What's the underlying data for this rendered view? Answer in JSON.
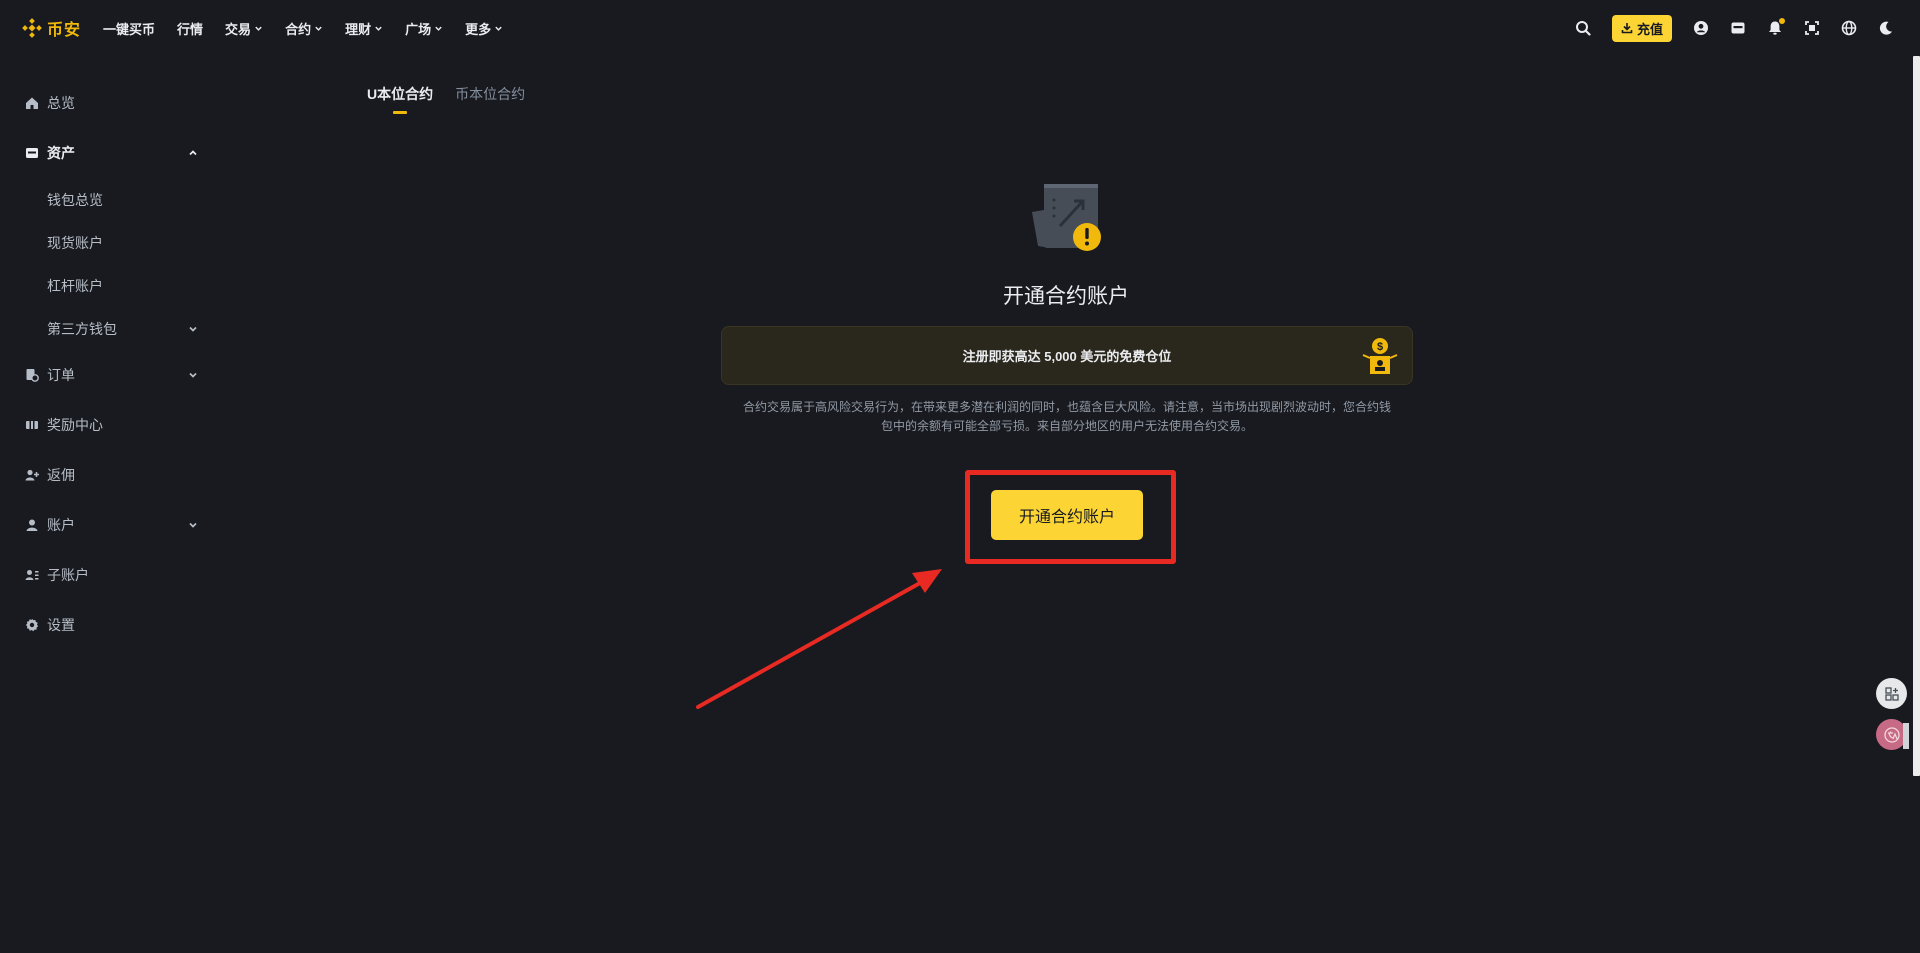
{
  "topbar": {
    "logo_text": "币安",
    "nav": [
      {
        "label": "一键买币",
        "has_dropdown": false
      },
      {
        "label": "行情",
        "has_dropdown": false
      },
      {
        "label": "交易",
        "has_dropdown": true
      },
      {
        "label": "合约",
        "has_dropdown": true
      },
      {
        "label": "理财",
        "has_dropdown": true
      },
      {
        "label": "广场",
        "has_dropdown": true
      },
      {
        "label": "更多",
        "has_dropdown": true
      }
    ],
    "deposit_label": "充值",
    "icons": [
      "search-icon",
      "download-icon",
      "user-icon",
      "wallet-icon",
      "bell-icon",
      "scan-icon",
      "globe-icon",
      "moon-icon"
    ]
  },
  "sidebar": {
    "items": [
      {
        "label": "总览",
        "icon": "home-icon"
      },
      {
        "label": "资产",
        "icon": "wallet-icon",
        "active": true,
        "expanded": true
      },
      {
        "label": "钱包总览",
        "sub": true
      },
      {
        "label": "现货账户",
        "sub": true
      },
      {
        "label": "杠杆账户",
        "sub": true
      },
      {
        "label": "第三方钱包",
        "sub": true,
        "has_dropdown": true
      },
      {
        "label": "订单",
        "icon": "order-icon",
        "has_dropdown": true
      },
      {
        "label": "奖励中心",
        "icon": "reward-icon"
      },
      {
        "label": "返佣",
        "icon": "referral-icon"
      },
      {
        "label": "账户",
        "icon": "user-icon",
        "has_dropdown": true
      },
      {
        "label": "子账户",
        "icon": "subaccount-icon"
      },
      {
        "label": "设置",
        "icon": "gear-icon"
      }
    ]
  },
  "tabs": [
    {
      "label": "U本位合约",
      "active": true
    },
    {
      "label": "币本位合约",
      "active": false
    }
  ],
  "main": {
    "title": "开通合约账户",
    "promo_text": "注册即获高达 5,000 美元的免费仓位",
    "disclaimer_line1": "合约交易属于高风险交易行为，在带来更多潜在利润的同时，也蕴含巨大风险。请注意，当市场出现剧烈波动时，您合约钱",
    "disclaimer_line2": "包中的余额有可能全部亏损。来自部分地区的用户无法使用合约交易。",
    "open_button_label": "开通合约账户"
  },
  "colors": {
    "background": "#181a20",
    "accent": "#fcd535",
    "brand": "#f0b90b",
    "annotation": "#e82a22"
  }
}
